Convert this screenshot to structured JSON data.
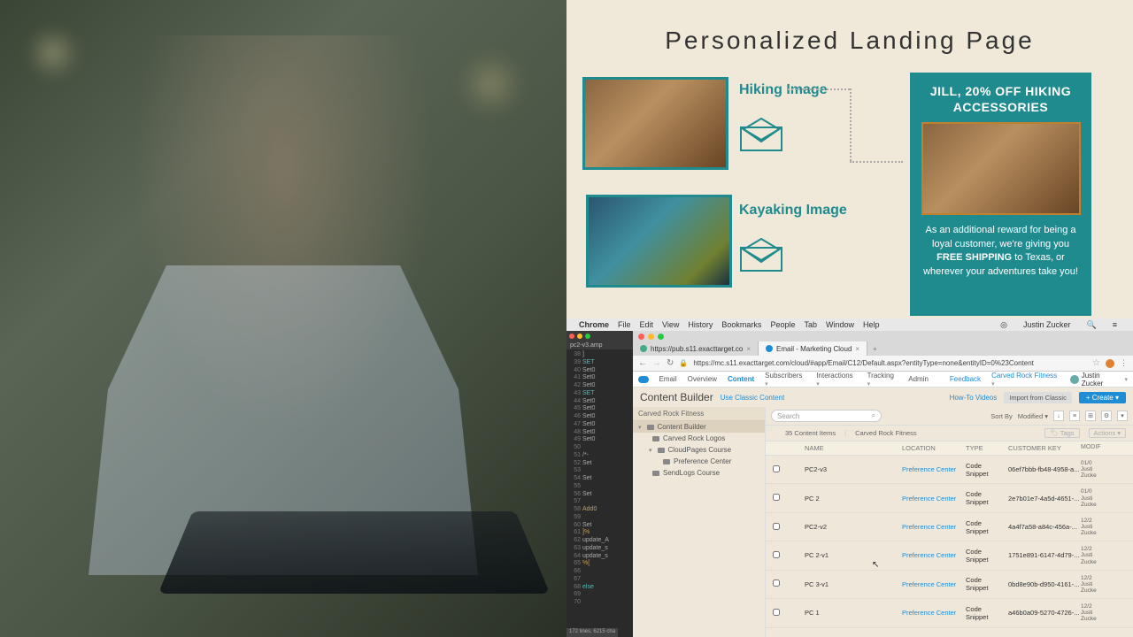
{
  "diagram": {
    "title": "Personalized Landing Page",
    "hiking_label": "Hiking Image",
    "kayak_label": "Kayaking Image",
    "card_title": "JILL, 20% OFF HIKING ACCESSORIES",
    "card_free_ship": "FREE SHIPPING",
    "card_line1": "As an additional reward for being a loyal customer, we're giving you ",
    "card_line2": " to Texas, or wherever your adventures take you!"
  },
  "mac_menu": {
    "app": "Chrome",
    "items": [
      "File",
      "Edit",
      "View",
      "History",
      "Bookmarks",
      "People",
      "Tab",
      "Window",
      "Help"
    ],
    "user": "Justin Zucker"
  },
  "editor": {
    "tab": "pc2-v3.amp",
    "lines": [
      {
        "n": 38,
        "t": "]",
        "c": "id"
      },
      {
        "n": 39,
        "t": "SET",
        "c": "kw"
      },
      {
        "n": 40,
        "t": "Set0",
        "c": "id"
      },
      {
        "n": 41,
        "t": "Set0",
        "c": "id"
      },
      {
        "n": 42,
        "t": "Set0",
        "c": "id"
      },
      {
        "n": 43,
        "t": "SET",
        "c": "kw"
      },
      {
        "n": 44,
        "t": "Set0",
        "c": "id"
      },
      {
        "n": 45,
        "t": "Set0",
        "c": "id"
      },
      {
        "n": 46,
        "t": "Set0",
        "c": "id"
      },
      {
        "n": 47,
        "t": "Set0",
        "c": "id"
      },
      {
        "n": 48,
        "t": "Set0",
        "c": "id"
      },
      {
        "n": 49,
        "t": "Set0",
        "c": "id"
      },
      {
        "n": 50,
        "t": "",
        "c": "id"
      },
      {
        "n": 51,
        "t": "/*-",
        "c": "id"
      },
      {
        "n": 52,
        "t": "Set",
        "c": "id"
      },
      {
        "n": 53,
        "t": "",
        "c": "id"
      },
      {
        "n": 54,
        "t": "Set",
        "c": "id"
      },
      {
        "n": 55,
        "t": "",
        "c": "id"
      },
      {
        "n": 56,
        "t": "Set",
        "c": "id"
      },
      {
        "n": 57,
        "t": "",
        "c": "id"
      },
      {
        "n": 58,
        "t": "Add0",
        "c": "fn"
      },
      {
        "n": 59,
        "t": "",
        "c": "id"
      },
      {
        "n": 60,
        "t": "Set",
        "c": "id"
      },
      {
        "n": 61,
        "t": "]%",
        "c": "fn"
      },
      {
        "n": 62,
        "t": "update_A",
        "c": "id"
      },
      {
        "n": 63,
        "t": "update_s",
        "c": "id"
      },
      {
        "n": 64,
        "t": "update_s",
        "c": "id"
      },
      {
        "n": 65,
        "t": "%[",
        "c": "fn"
      },
      {
        "n": 66,
        "t": "",
        "c": "id"
      },
      {
        "n": 67,
        "t": "",
        "c": "id"
      },
      {
        "n": 68,
        "t": "else",
        "c": "kw"
      },
      {
        "n": 69,
        "t": "",
        "c": "id"
      },
      {
        "n": 70,
        "t": "",
        "c": "id"
      }
    ],
    "status": "172 lines, 6215 cha"
  },
  "browser": {
    "tabs": [
      {
        "label": "https://pub.s11.exacttarget.co"
      },
      {
        "label": "Email - Marketing Cloud"
      }
    ],
    "url": "https://mc.s11.exacttarget.com/cloud/#app/Email/C12/Default.aspx?entityType=none&entityID=0%23Content",
    "nav": {
      "product": "Email",
      "items": [
        "Overview",
        "Content",
        "Subscribers",
        "Interactions",
        "Tracking",
        "Admin"
      ],
      "feedback": "Feedback",
      "org": "Carved Rock Fitness",
      "user": "Justin Zucker"
    },
    "cb": {
      "title": "Content Builder",
      "classic": "Use Classic Content",
      "howto": "How-To Videos",
      "import": "Import from Classic",
      "create": "Create"
    },
    "tree": {
      "head": "Carved Rock Fitness",
      "root": "Content Builder",
      "logos": "Carved Rock Logos",
      "course": "CloudPages Course",
      "pref": "Preference Center",
      "send": "SendLogs Course"
    },
    "list": {
      "search_ph": "Search",
      "sort_label": "Sort By",
      "sort_value": "Modified",
      "count": "35 Content Items",
      "crumb": "Carved Rock Fitness",
      "tags": "Tags",
      "actions": "Actions",
      "headers": {
        "name": "NAME",
        "loc": "LOCATION",
        "type": "TYPE",
        "key": "CUSTOMER KEY",
        "mod": "MODIF"
      },
      "rows": [
        {
          "name": "PC2-v3",
          "loc": "Preference Center",
          "type": "Code Snippet",
          "key": "06ef7bbb-fb48-4958-a...",
          "mod": "01/0\nJusti\nZucke"
        },
        {
          "name": "PC 2",
          "loc": "Preference Center",
          "type": "Code Snippet",
          "key": "2e7b01e7-4a5d-4651-...",
          "mod": "01/0\nJusti\nZucke"
        },
        {
          "name": "PC2-v2",
          "loc": "Preference Center",
          "type": "Code Snippet",
          "key": "4a4f7a58-a84c-456a-...",
          "mod": "12/2\nJusti\nZucke"
        },
        {
          "name": "PC 2-v1",
          "loc": "Preference Center",
          "type": "Code Snippet",
          "key": "1751e891-6147-4d79-...",
          "mod": "12/2\nJusti\nZucke"
        },
        {
          "name": "PC 3-v1",
          "loc": "Preference Center",
          "type": "Code Snippet",
          "key": "0bd8e90b-d950-4161-...",
          "mod": "12/2\nJusti\nZucke"
        },
        {
          "name": "PC 1",
          "loc": "Preference Center",
          "type": "Code Snippet",
          "key": "a46b0a09-5270-4726-...",
          "mod": "12/2\nJusti\nZucke"
        }
      ]
    }
  }
}
